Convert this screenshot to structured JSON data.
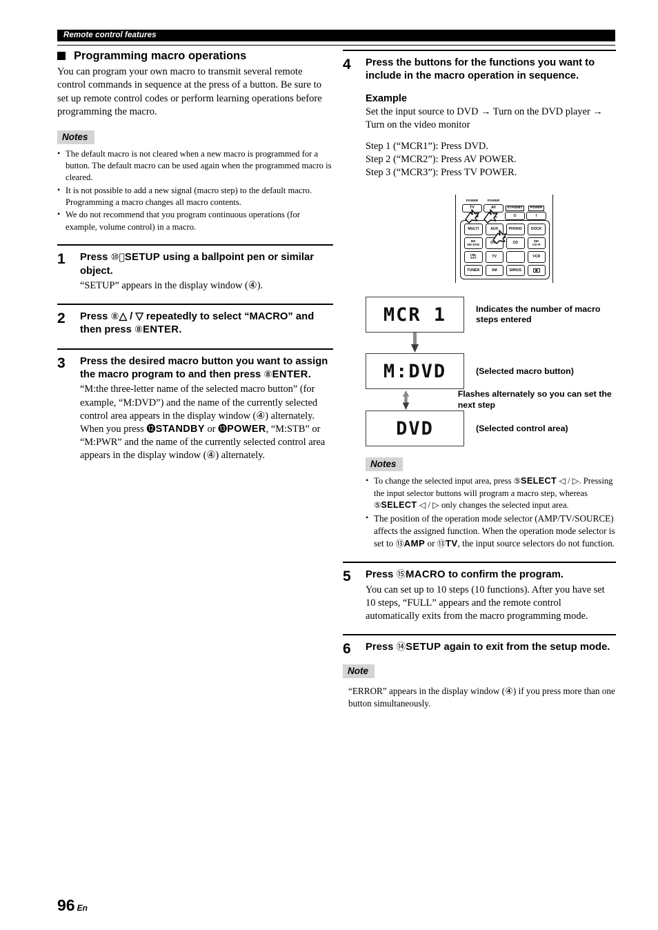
{
  "header": {
    "running_title": "Remote control features"
  },
  "section": {
    "title": "Programming macro operations",
    "intro": "You can program your own macro to transmit several remote control commands in sequence at the press of a button. Be sure to set up remote control codes or perform learning operations before programming the macro."
  },
  "notes_left": {
    "label": "Notes",
    "items": [
      "The default macro is not cleared when a new macro is programmed for a button. The default macro can be used again when the programmed macro is cleared.",
      "It is not possible to add a new signal (macro step) to the default macro. Programming a macro changes all macro contents.",
      "We do not recommend that you program continuous operations (for example, volume control) in a macro."
    ]
  },
  "steps": {
    "s1": {
      "num": "1",
      "title_a": "Press ",
      "ref": "⑩⃞",
      "title_key": "SETUP",
      "title_b": " using a ballpoint pen or similar object.",
      "desc": "“SETUP” appears in the display window (④)."
    },
    "s2": {
      "num": "2",
      "title_a": "Press ",
      "ref": "⑧",
      "title_b": "△ / ▽ repeatedly to select “MACRO” and then press ",
      "ref2": "⑧",
      "title_key": "ENTER",
      "title_c": "."
    },
    "s3": {
      "num": "3",
      "title_a": "Press the desired macro button you want to assign the macro program to and then press ",
      "ref": "⑧",
      "title_key": "ENTER",
      "title_b": ".",
      "desc_1": "“M:the three-letter name of the selected macro button” (for example, “M:DVD”) and the name of the currently selected control area appears in the display window (④) alternately.",
      "desc_2a": "When you press ",
      "desc_ref1": "⓬",
      "desc_key1": "STANDBY",
      "desc_2b": " or ",
      "desc_ref2": "⓭",
      "desc_key2": "POWER",
      "desc_2c": ", “M:STB” or “M:PWR” and the name of the currently selected control area appears in the display window (④) alternately."
    },
    "s4": {
      "num": "4",
      "title": "Press the buttons for the functions you want to include in the macro operation in sequence.",
      "example_label": "Example",
      "example_flow": "Set the input source to DVD → Turn on the DVD player → Turn on the video monitor",
      "example_steps": [
        "Step 1 (“MCR1”): Press DVD.",
        "Step 2 (“MCR2”): Press AV POWER.",
        "Step 3 (“MCR3”): Press TV POWER."
      ]
    },
    "s5": {
      "num": "5",
      "title_a": "Press ",
      "ref": "⑮",
      "title_key": "MACRO",
      "title_b": " to confirm the program.",
      "desc": "You can set up to 10 steps (10 functions). After you have set 10 steps, “FULL” appears and the remote control automatically exits from the macro programming mode."
    },
    "s6": {
      "num": "6",
      "title_a": "Press ",
      "ref": "⑭",
      "title_key": "SETUP",
      "title_b": " again to exit from the setup mode."
    }
  },
  "remote": {
    "top_buttons": [
      {
        "label": "POWER",
        "boxed": false,
        "key": "TV"
      },
      {
        "label": "POWER",
        "boxed": false,
        "key": "AV"
      },
      {
        "label": "STANDBY",
        "boxed": true,
        "key": "⏻"
      },
      {
        "label": "POWER",
        "boxed": true,
        "key": "I"
      }
    ],
    "pad_buttons": [
      "MULTI",
      "AUX",
      "PHONO",
      "DOCK",
      "BD\nHD DVD",
      "DVD",
      "CD",
      "MD\nCD-R",
      "CBL\nSAT",
      "TV",
      "",
      "VCR",
      "TUNER",
      "XM",
      "SIRIUS",
      "☰"
    ],
    "hand_markers": [
      "1",
      "2",
      "3"
    ]
  },
  "lcd_flow": {
    "steps": [
      {
        "display": "MCR 1",
        "caption": "Indicates the number of macro steps entered"
      },
      {
        "display": "M:DVD",
        "caption": "(Selected macro button)"
      },
      {
        "display": "DVD",
        "caption": "(Selected control area)"
      }
    ],
    "alt_caption": "Flashes alternately so you can set the next step"
  },
  "notes_right": {
    "label": "Notes",
    "items": [
      {
        "a": "To change the selected input area, press ",
        "ref": "⑤",
        "key": "SELECT",
        "b": " ◁ / ▷. Pressing the input selector buttons will program a macro step, whereas ",
        "ref2": "⑤",
        "key2": "SELECT",
        "c": " ◁ / ▷ only changes the selected input area."
      },
      {
        "a": "The position of the operation mode selector (AMP/TV/SOURCE) affects the assigned function. When the operation mode selector is set to ",
        "ref": "⑬",
        "key": "AMP",
        "b": " or ",
        "ref2": "⑬",
        "key2": "TV",
        "c": ", the input source selectors do not function."
      }
    ]
  },
  "note_final": {
    "label": "Note",
    "text": "“ERROR” appears in the display window (④) if you press more than one button simultaneously."
  },
  "footer": {
    "page": "96",
    "lang": "En"
  }
}
